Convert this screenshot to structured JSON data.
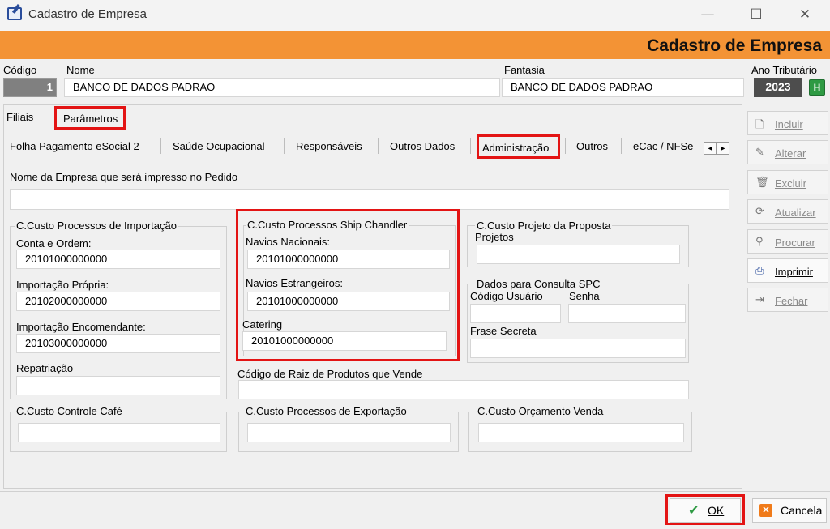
{
  "window": {
    "title": "Cadastro de Empresa",
    "minimize": "—",
    "maximize": "☐",
    "close": "✕"
  },
  "banner": {
    "title": "Cadastro de Empresa"
  },
  "header": {
    "codigo_label": "Código",
    "codigo_value": "1",
    "nome_label": "Nome",
    "nome_value": "BANCO DE DADOS PADRAO",
    "fantasia_label": "Fantasia",
    "fantasia_value": "BANCO DE DADOS PADRAO",
    "ano_label": "Ano Tributário",
    "ano_value": "2023",
    "h_button": "H"
  },
  "top_tabs": [
    {
      "label": "Filiais"
    },
    {
      "label": "Parâmetros"
    }
  ],
  "sub_tabs": [
    {
      "label": "Folha Pagamento eSocial 2"
    },
    {
      "label": "Saúde Ocupacional"
    },
    {
      "label": "Responsáveis"
    },
    {
      "label": "Outros Dados"
    },
    {
      "label": "Administração"
    },
    {
      "label": "Outros"
    },
    {
      "label": "eCac / NFSe"
    }
  ],
  "scroll": {
    "left": "◂",
    "right": "▸"
  },
  "form": {
    "pedido_label": "Nome da Empresa que será impresso no Pedido",
    "pedido_value": "",
    "importacao": {
      "title": "C.Custo Processos de Importação",
      "conta_ordem_label": "Conta e Ordem:",
      "conta_ordem_value": "20101000000000",
      "propria_label": "Importação Própria:",
      "propria_value": "20102000000000",
      "encomendante_label": "Importação Encomendante:",
      "encomendante_value": "20103000000000",
      "repatriacao_label": "Repatriação",
      "repatriacao_value": ""
    },
    "ship": {
      "title": "C.Custo Processos Ship Chandler",
      "nacionais_label": "Navios Nacionais:",
      "nacionais_value": "20101000000000",
      "estrangeiros_label": "Navios Estrangeiros:",
      "estrangeiros_value": "20101000000000",
      "catering_label": "Catering",
      "catering_value": "20101000000000"
    },
    "projeto": {
      "title": "C.Custo Projeto da Proposta",
      "projetos_label": "Projetos",
      "projetos_value": ""
    },
    "spc": {
      "title": "Dados para Consulta SPC",
      "usuario_label": "Código Usuário",
      "usuario_value": "",
      "senha_label": "Senha",
      "senha_value": "",
      "frase_label": "Frase Secreta",
      "frase_value": ""
    },
    "raiz_label": "Código de Raiz de Produtos que Vende",
    "raiz_value": "",
    "cafe": {
      "title": "C.Custo Controle Café",
      "value": ""
    },
    "exportacao": {
      "title": "C.Custo Processos de Exportação",
      "value": ""
    },
    "orcamento": {
      "title": "C.Custo Orçamento Venda",
      "value": ""
    }
  },
  "side_buttons": [
    {
      "label": "Incluir",
      "icon": "document-icon"
    },
    {
      "label": "Alterar",
      "icon": "pencil-icon"
    },
    {
      "label": "Excluir",
      "icon": "trash-icon"
    },
    {
      "label": "Atualizar",
      "icon": "refresh-icon"
    },
    {
      "label": "Procurar",
      "icon": "binoculars-icon"
    },
    {
      "label": "Imprimir",
      "icon": "printer-icon"
    },
    {
      "label": "Fechar",
      "icon": "door-icon"
    }
  ],
  "footer": {
    "ok_label": "OK",
    "cancel_label": "Cancela"
  },
  "colors": {
    "banner": "#f39335",
    "highlight": "#e31414",
    "ok_check": "#2e9a43",
    "cancel": "#f07b1a"
  }
}
